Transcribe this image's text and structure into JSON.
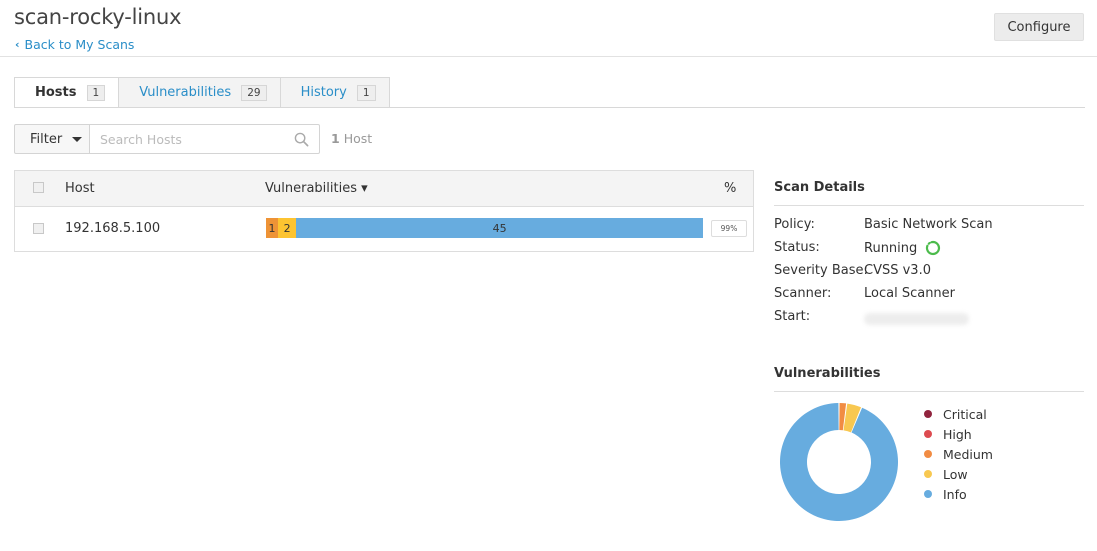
{
  "header": {
    "title": "scan-rocky-linux",
    "back_label": "Back to My Scans",
    "configure_label": "Configure"
  },
  "tabs": [
    {
      "label": "Hosts",
      "count": "1",
      "active": true
    },
    {
      "label": "Vulnerabilities",
      "count": "29",
      "active": false
    },
    {
      "label": "History",
      "count": "1",
      "active": false
    }
  ],
  "toolbar": {
    "filter_label": "Filter",
    "search_placeholder": "Search Hosts",
    "host_count_number": "1",
    "host_count_label": "Host"
  },
  "table": {
    "headers": {
      "host": "Host",
      "vulnerabilities": "Vulnerabilities ▾",
      "percent": "%"
    },
    "rows": [
      {
        "host": "192.168.5.100",
        "segments": [
          {
            "severity": "medium",
            "count": 1,
            "label": "1",
            "color": "#ee9336"
          },
          {
            "severity": "low",
            "count": 2,
            "label": "2",
            "color": "#fdc431"
          },
          {
            "severity": "info",
            "count": 45,
            "label": "45",
            "color": "#67acdf"
          }
        ],
        "percent": "99%"
      }
    ]
  },
  "scan_details": {
    "title": "Scan Details",
    "rows": [
      {
        "label": "Policy:",
        "value": "Basic Network Scan"
      },
      {
        "label": "Status:",
        "value": "Running"
      },
      {
        "label": "Severity Base:",
        "value": "CVSS v3.0"
      },
      {
        "label": "Scanner:",
        "value": "Local Scanner"
      },
      {
        "label": "Start:",
        "value": ""
      }
    ],
    "status_icon": "running-spinner-icon",
    "status_icon_color": "#4cbb4c"
  },
  "vulnerabilities_panel": {
    "title": "Vulnerabilities",
    "legend": [
      {
        "label": "Critical",
        "color": "#91243e"
      },
      {
        "label": "High",
        "color": "#dd4b50"
      },
      {
        "label": "Medium",
        "color": "#f18c43"
      },
      {
        "label": "Low",
        "color": "#f8c851"
      },
      {
        "label": "Info",
        "color": "#67acdf"
      }
    ]
  },
  "chart_data": {
    "type": "pie",
    "title": "Vulnerabilities",
    "categories": [
      "Critical",
      "High",
      "Medium",
      "Low",
      "Info"
    ],
    "values": [
      0,
      0,
      1,
      2,
      45
    ],
    "colors": [
      "#91243e",
      "#dd4b50",
      "#f18c43",
      "#f8c851",
      "#67acdf"
    ],
    "donut": true
  }
}
